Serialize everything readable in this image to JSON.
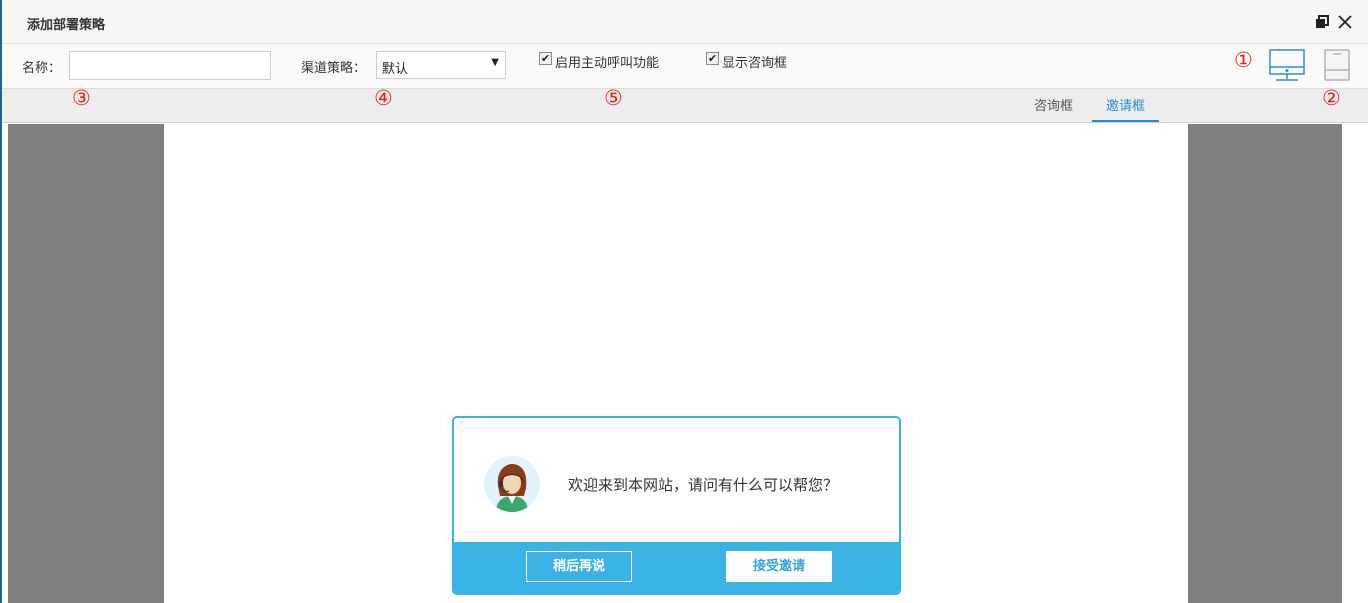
{
  "window": {
    "title": "添加部署策略"
  },
  "toolbar": {
    "name_label": "名称：",
    "name_value": "",
    "channel_label": "渠道策略：",
    "channel_value": "默认",
    "proactive_label": "启用主动呼叫功能",
    "proactive_checked": true,
    "show_consult_label": "显示咨询框",
    "show_consult_checked": true
  },
  "markers": {
    "m1": "①",
    "m2": "②",
    "m3": "③",
    "m4": "④",
    "m5": "⑤"
  },
  "device_icons": [
    "desktop-icon",
    "mobile-icon"
  ],
  "tabs": [
    {
      "label": "咨询框",
      "active": false
    },
    {
      "label": "邀请框",
      "active": true
    }
  ],
  "invite_dialog": {
    "message": "欢迎来到本网站，请问有什么可以帮您？",
    "later_button": "稍后再说",
    "accept_button": "接受邀请"
  },
  "colors": {
    "accent": "#39b2e6",
    "tab_active": "#1f8fd6",
    "marker_red": "#e8231b",
    "preview_bg": "#7f7f7f"
  }
}
